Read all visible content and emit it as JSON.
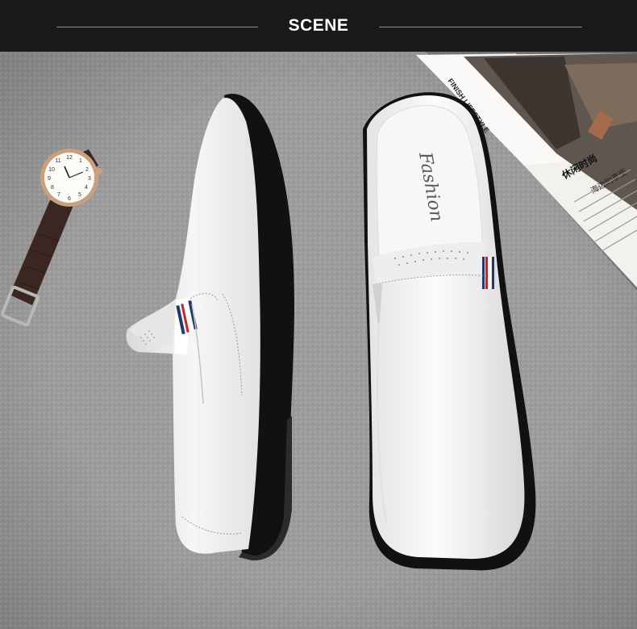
{
  "header": {
    "title": "SCENE"
  },
  "insole_text": "Fashion",
  "magazine": {
    "headline": "休闲时尚",
    "subline": "海边的享受",
    "band": "FINISH LIFESTYLE"
  },
  "colors": {
    "header_bg": "#191919",
    "carpet": "#9c9c9c",
    "shoe": "#f1f1f1",
    "sole": "#111111",
    "strap": "#3b2622"
  }
}
